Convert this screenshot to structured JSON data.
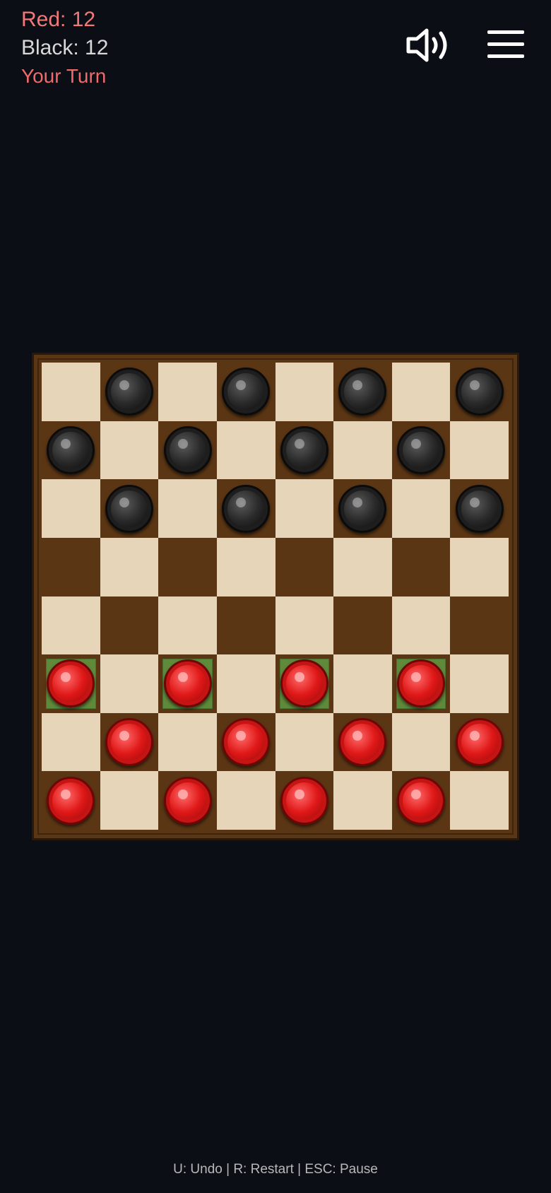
{
  "hud": {
    "red_score": "Red: 12",
    "black_score": "Black: 12",
    "turn": "Your Turn"
  },
  "icons": {
    "sound": "speaker-volume-icon",
    "menu": "hamburger-menu-icon"
  },
  "colors": {
    "background": "#0b0e14",
    "light_square": "#e6d5b8",
    "dark_square": "#5b3614",
    "highlight": "#5e8a3a",
    "red_piece": "#e01818",
    "black_piece": "#1e1e1e"
  },
  "board": {
    "rows": [
      [
        "",
        "b",
        "",
        "b",
        "",
        "b",
        "",
        "b"
      ],
      [
        "b",
        "",
        "b",
        "",
        "b",
        "",
        "b",
        ""
      ],
      [
        "",
        "b",
        "",
        "b",
        "",
        "b",
        "",
        "b"
      ],
      [
        "",
        "",
        "",
        "",
        "",
        "",
        "",
        ""
      ],
      [
        "",
        "",
        "",
        "",
        "",
        "",
        "",
        ""
      ],
      [
        "r",
        "",
        "r",
        "",
        "r",
        "",
        "r",
        ""
      ],
      [
        "",
        "r",
        "",
        "r",
        "",
        "r",
        "",
        "r"
      ],
      [
        "r",
        "",
        "r",
        "",
        "r",
        "",
        "r",
        ""
      ]
    ],
    "movable": [
      [
        5,
        0
      ],
      [
        5,
        2
      ],
      [
        5,
        4
      ],
      [
        5,
        6
      ]
    ]
  },
  "footer": "U: Undo | R: Restart | ESC: Pause"
}
